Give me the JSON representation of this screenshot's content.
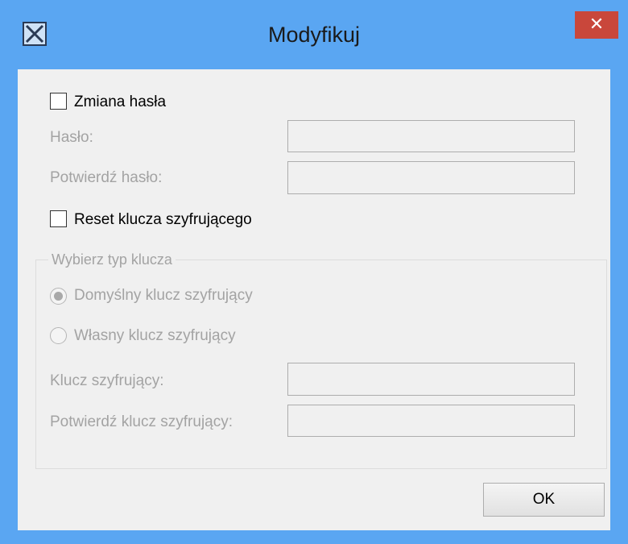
{
  "window": {
    "title": "Modyfikuj",
    "close_glyph": "✕",
    "app_icon": "x-app-icon"
  },
  "password_section": {
    "checkbox_label": "Zmiana hasła",
    "checked": false,
    "password_label": "Hasło:",
    "confirm_label": "Potwierdź hasło:",
    "password_value": "",
    "confirm_value": ""
  },
  "key_reset": {
    "checkbox_label": "Reset klucza szyfrującego",
    "checked": false
  },
  "key_type_group": {
    "title": "Wybierz typ klucza",
    "options": [
      {
        "label": "Domyślny klucz szyfrujący",
        "selected": true
      },
      {
        "label": "Własny klucz szyfrujący",
        "selected": false
      }
    ],
    "key_label": "Klucz szyfrujący:",
    "confirm_key_label": "Potwierdź klucz szyfrujący:",
    "key_value": "",
    "confirm_key_value": ""
  },
  "buttons": {
    "ok": "OK"
  },
  "colors": {
    "titlebar": "#5aa6f2",
    "close": "#c9473b",
    "client": "#f0f0f0",
    "disabled_text": "#a3a3a3"
  }
}
